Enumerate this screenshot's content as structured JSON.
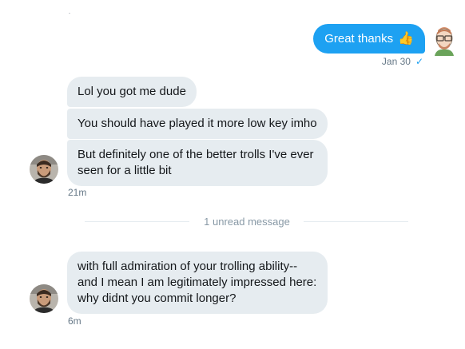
{
  "outgoing": {
    "text": "Great thanks",
    "emoji": "👍",
    "date": "Jan 30",
    "check": "✓"
  },
  "thread1": {
    "messages": [
      "Lol you got me dude",
      "You should have played it more low key imho",
      "But definitely one of the better trolls I've ever seen for a little bit"
    ],
    "time": "21m"
  },
  "divider": {
    "text": "1 unread message"
  },
  "thread2": {
    "message": "with full admiration of your trolling ability--and I mean I am legitimately impressed here: why didnt you commit longer?",
    "time": "6m"
  },
  "colors": {
    "outgoing_bubble": "#1da1f2",
    "incoming_bubble": "#e6ecf0",
    "meta_text": "#657786",
    "divider_text": "#8899a6"
  }
}
